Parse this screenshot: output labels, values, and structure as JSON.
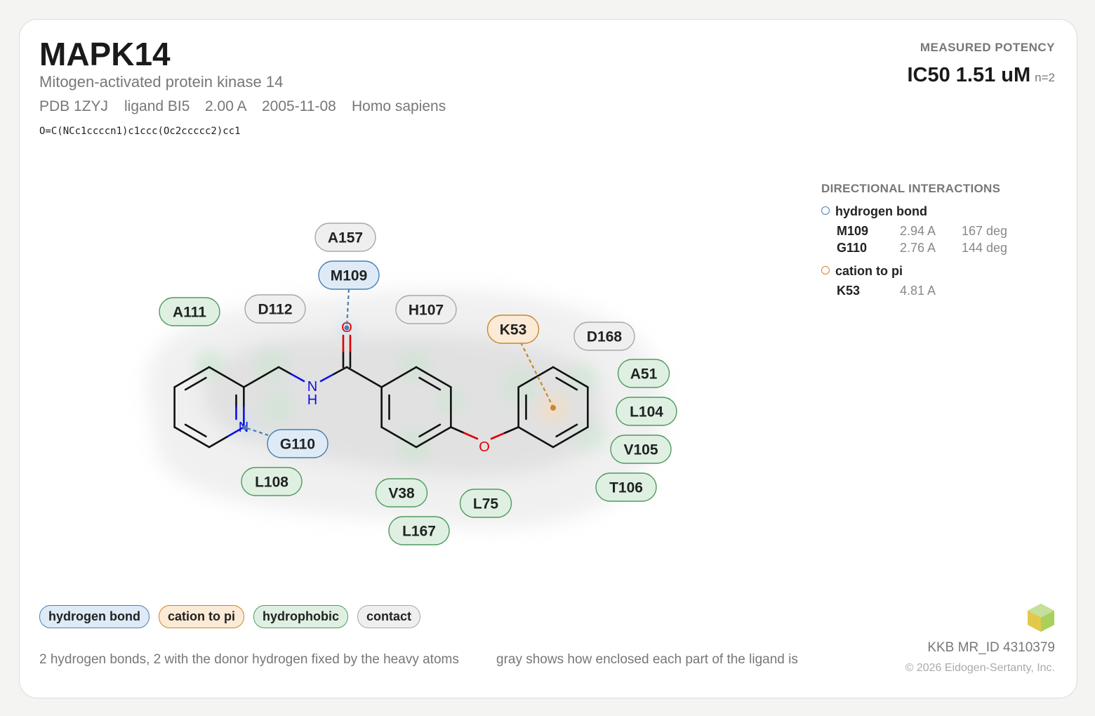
{
  "header": {
    "title": "MAPK14",
    "subtitle": "Mitogen-activated protein kinase 14",
    "pdb": "PDB 1ZYJ",
    "ligand": "ligand BI5",
    "resolution": "2.00 A",
    "date": "2005-11-08",
    "organism": "Homo sapiens",
    "smiles": "O=C(NCc1ccccn1)c1ccc(Oc2ccccc2)cc1"
  },
  "potency": {
    "label": "MEASURED POTENCY",
    "value": "IC50 1.51 uM",
    "n": "n=2"
  },
  "interactions": {
    "heading": "DIRECTIONAL INTERACTIONS",
    "hbond": {
      "type": "hydrogen bond",
      "rows": [
        {
          "residue": "M109",
          "distance": "2.94 A",
          "angle": "167 deg"
        },
        {
          "residue": "G110",
          "distance": "2.76 A",
          "angle": "144 deg"
        }
      ]
    },
    "cation_pi": {
      "type": "cation to pi",
      "rows": [
        {
          "residue": "K53",
          "distance": "4.81 A"
        }
      ]
    }
  },
  "colors": {
    "hbond_fill": "#deebf7",
    "hbond_stroke": "#4a7fb0",
    "cation_fill": "#fbead5",
    "cation_stroke": "#c8872f",
    "hydrophobic_fill": "#dff0e2",
    "hydrophobic_stroke": "#4f9a5f",
    "contact_fill": "#efefef",
    "contact_stroke": "#a8a8a8",
    "carbon": "#111111",
    "nitrogen": "#1010e0",
    "oxygen": "#e00000"
  },
  "residues": [
    {
      "label": "A157",
      "kind": "contact"
    },
    {
      "label": "M109",
      "kind": "hbond"
    },
    {
      "label": "A111",
      "kind": "hydrophobic"
    },
    {
      "label": "D112",
      "kind": "contact"
    },
    {
      "label": "H107",
      "kind": "contact"
    },
    {
      "label": "K53",
      "kind": "cation"
    },
    {
      "label": "D168",
      "kind": "contact"
    },
    {
      "label": "A51",
      "kind": "hydrophobic"
    },
    {
      "label": "L104",
      "kind": "hydrophobic"
    },
    {
      "label": "V105",
      "kind": "hydrophobic"
    },
    {
      "label": "T106",
      "kind": "hydrophobic"
    },
    {
      "label": "G110",
      "kind": "hbond"
    },
    {
      "label": "L108",
      "kind": "hydrophobic"
    },
    {
      "label": "V38",
      "kind": "hydrophobic"
    },
    {
      "label": "L75",
      "kind": "hydrophobic"
    },
    {
      "label": "L167",
      "kind": "hydrophobic"
    }
  ],
  "atoms": {
    "N": "N",
    "NH_N": "N",
    "NH_H": "H",
    "O_carbonyl": "O",
    "O_ether": "O"
  },
  "legend": [
    "hydrogen bond",
    "cation to pi",
    "hydrophobic",
    "contact"
  ],
  "footer": {
    "note1": "2 hydrogen bonds, 2 with the donor hydrogen fixed by the heavy atoms",
    "note2": "gray shows how enclosed each part of the ligand is",
    "mr_id": "KKB MR_ID 4310379",
    "copyright": "© 2026 Eidogen-Sertanty, Inc."
  }
}
